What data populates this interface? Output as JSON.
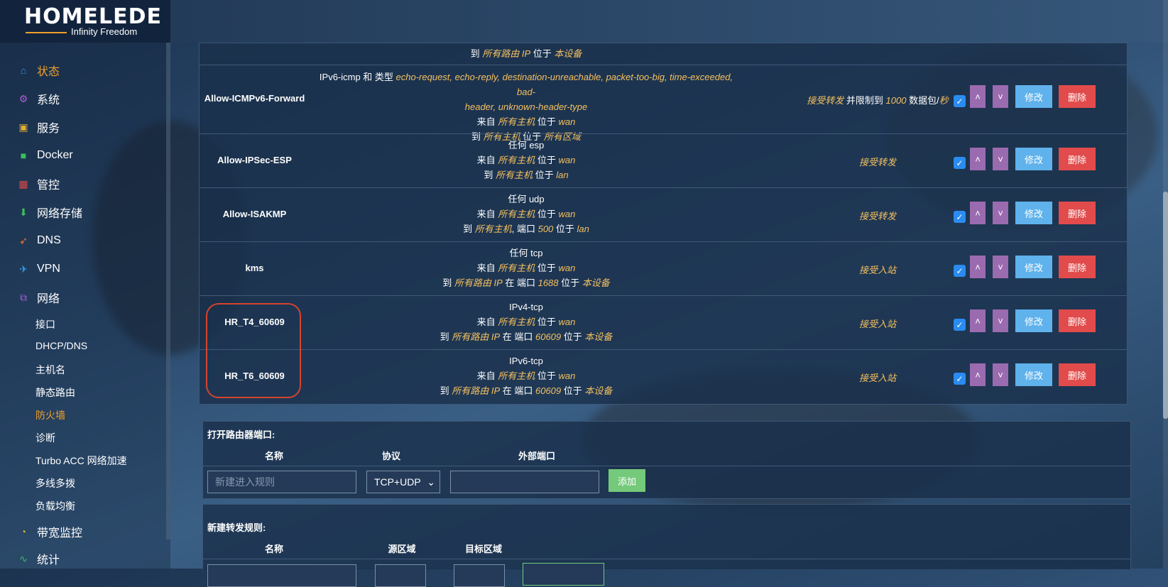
{
  "brand": {
    "name": "HOMELEDE",
    "tagline": "Infinity Freedom"
  },
  "sidebar": {
    "items": [
      {
        "label": "状态",
        "icon": "home-icon"
      },
      {
        "label": "系统",
        "icon": "gear-icon"
      },
      {
        "label": "服务",
        "icon": "service-icon"
      },
      {
        "label": "Docker",
        "icon": "docker-icon"
      },
      {
        "label": "管控",
        "icon": "control-icon"
      },
      {
        "label": "网络存储",
        "icon": "storage-icon"
      },
      {
        "label": "DNS",
        "icon": "rocket-icon"
      },
      {
        "label": "VPN",
        "icon": "plane-icon"
      },
      {
        "label": "网络",
        "icon": "network-icon"
      }
    ],
    "network_sub": [
      "接口",
      "DHCP/DNS",
      "主机名",
      "静态路由",
      "防火墙",
      "诊断",
      "Turbo ACC 网络加速",
      "多线多拨",
      "负载均衡"
    ],
    "bottom_items": [
      {
        "label": "带宽监控",
        "icon": "bandwidth-icon"
      },
      {
        "label": "统计",
        "icon": "chart-icon"
      }
    ]
  },
  "rules": {
    "top_partial": {
      "line": [
        "到 ",
        "所有路由 IP",
        " 位于 ",
        "本设备"
      ]
    },
    "rows": [
      {
        "name": "Allow-ICMPv6-Forward",
        "match": [
          [
            "IPv6-icmp 和 类型 ",
            "echo-request, echo-reply, destination-unreachable, packet-too-big, time-exceeded, bad-",
            ""
          ],
          [
            "",
            "header, unknown-header-type",
            ""
          ],
          [
            "来自 ",
            "所有主机",
            " 位于 ",
            "wan"
          ],
          [
            "到 ",
            "所有主机",
            " 位于 ",
            "所有区域"
          ]
        ],
        "action": [
          "接受转发",
          " 并限制到 ",
          "1000",
          " 数据包/",
          "秒"
        ]
      },
      {
        "name": "Allow-IPSec-ESP",
        "match": [
          [
            "任何 esp"
          ],
          [
            "来自 ",
            "所有主机",
            " 位于 ",
            "wan"
          ],
          [
            "到 ",
            "所有主机",
            " 位于 ",
            "lan"
          ]
        ],
        "action": [
          "接受转发"
        ]
      },
      {
        "name": "Allow-ISAKMP",
        "match": [
          [
            "任何 udp"
          ],
          [
            "来自 ",
            "所有主机",
            " 位于 ",
            "wan"
          ],
          [
            "到 ",
            "所有主机",
            ", 端口 ",
            "500",
            " 位于 ",
            "lan"
          ]
        ],
        "action": [
          "接受转发"
        ]
      },
      {
        "name": "kms",
        "match": [
          [
            "任何 tcp"
          ],
          [
            "来自 ",
            "所有主机",
            " 位于 ",
            "wan"
          ],
          [
            "到 ",
            "所有路由 IP",
            " 在 端口 ",
            "1688",
            " 位于 ",
            "本设备"
          ]
        ],
        "action": [
          "接受入站"
        ]
      },
      {
        "name": "HR_T4_60609",
        "match": [
          [
            "IPv4-tcp"
          ],
          [
            "来自 ",
            "所有主机",
            " 位于 ",
            "wan"
          ],
          [
            "到 ",
            "所有路由 IP",
            " 在 端口 ",
            "60609",
            " 位于 ",
            "本设备"
          ]
        ],
        "action": [
          "接受入站"
        ]
      },
      {
        "name": "HR_T6_60609",
        "match": [
          [
            "IPv6-tcp"
          ],
          [
            "来自 ",
            "所有主机",
            " 位于 ",
            "wan"
          ],
          [
            "到 ",
            "所有路由 IP",
            " 在 端口 ",
            "60609",
            " 位于 ",
            "本设备"
          ]
        ],
        "action": [
          "接受入站"
        ]
      }
    ],
    "buttons": {
      "up": "˄",
      "down": "˅",
      "edit": "修改",
      "delete": "删除"
    }
  },
  "open_ports": {
    "title": "打开路由器端口:",
    "columns": [
      "名称",
      "协议",
      "外部端口"
    ],
    "name_placeholder": "新建进入规则",
    "protocol_value": "TCP+UDP",
    "add_label": "添加"
  },
  "forward": {
    "title": "新建转发规则:",
    "columns": [
      "名称",
      "源区域",
      "目标区域"
    ]
  }
}
